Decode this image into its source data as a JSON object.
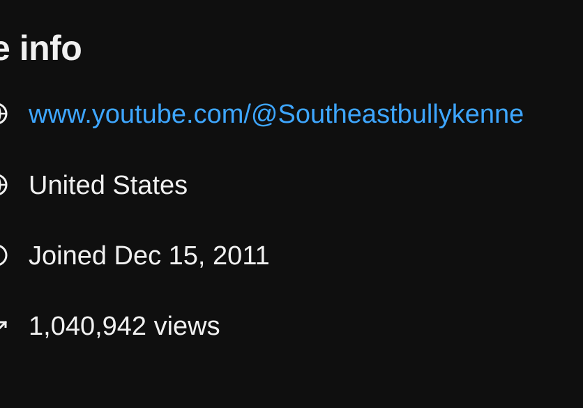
{
  "more_info": {
    "title": "ore info",
    "rows": [
      {
        "icon": "globe-icon",
        "text": "www.youtube.com/@Southeastbullykenne"
      },
      {
        "icon": "globe-icon",
        "text": "United States"
      },
      {
        "icon": "info-circle-icon",
        "text": "Joined Dec 15, 2011"
      },
      {
        "icon": "trending-up-icon",
        "text": "1,040,942 views"
      }
    ]
  },
  "colors": {
    "background": "#0f0f0f",
    "text": "#f1f1f1",
    "link": "#3ea6ff"
  }
}
